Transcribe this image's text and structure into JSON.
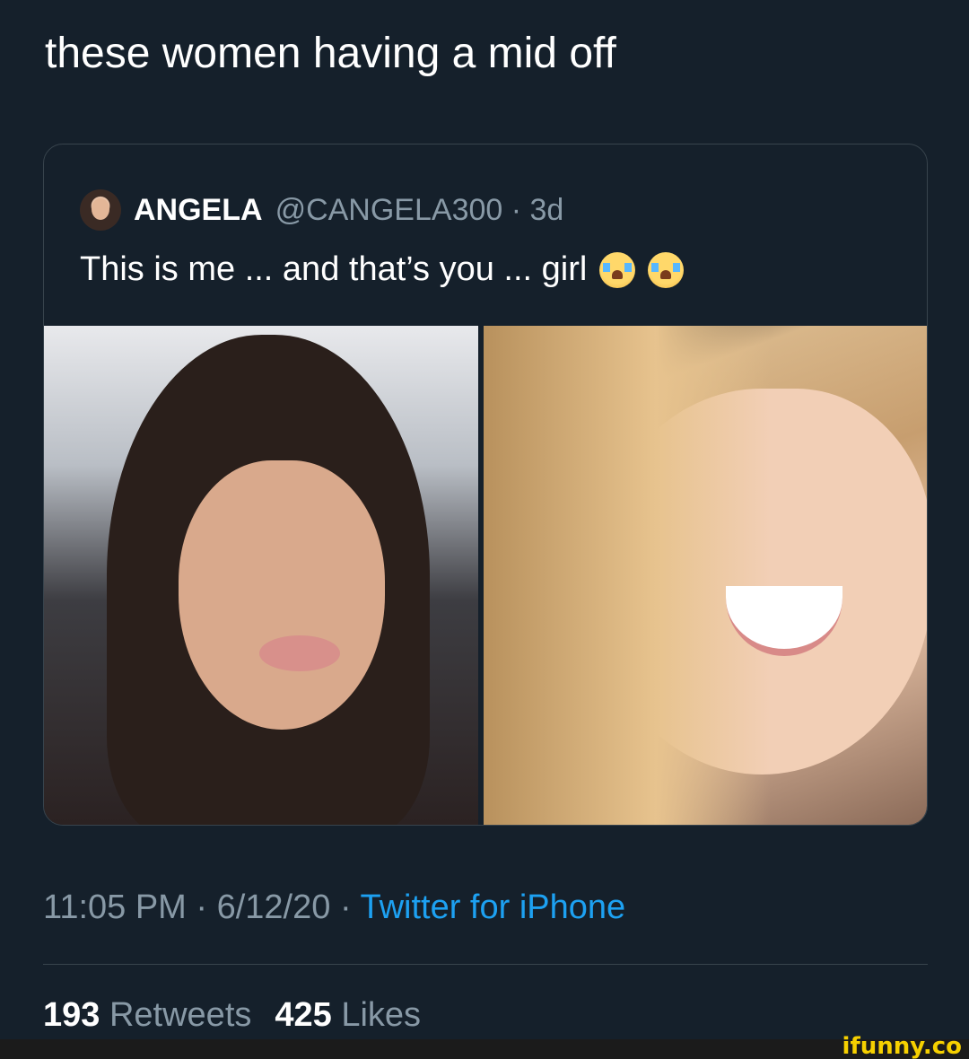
{
  "tweet": {
    "text": "these women having a mid off",
    "timestamp": "11:05 PM · 6/12/20 · ",
    "source": "Twitter for iPhone",
    "retweets_count": "193",
    "retweets_label": "Retweets",
    "likes_count": "425",
    "likes_label": "Likes"
  },
  "quoted": {
    "display_name": "ANGELA",
    "handle": "@CANGELA300 · 3d",
    "text": "This is me ... and that’s you ... girl",
    "emoji": [
      "loudly-crying-face-icon",
      "loudly-crying-face-icon"
    ]
  },
  "watermark": "ifunny.co",
  "colors": {
    "background": "#15202b",
    "link": "#1da1f2",
    "muted": "#8899a6",
    "watermark": "#f6d000"
  }
}
